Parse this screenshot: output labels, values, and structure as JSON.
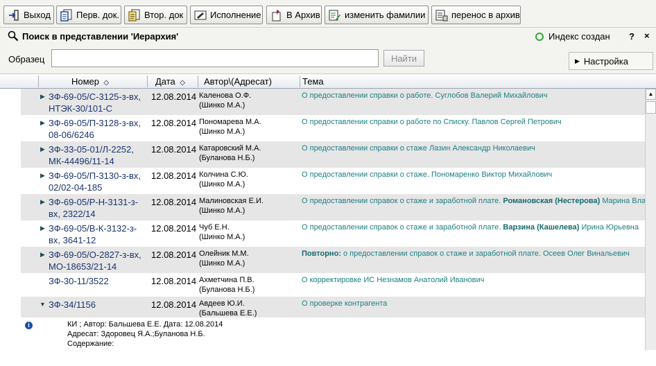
{
  "toolbar": {
    "buttons": [
      {
        "label": "Выход",
        "icon": "exit-icon"
      },
      {
        "label": "Перв. док.",
        "icon": "primary-doc-icon"
      },
      {
        "label": "Втор. док",
        "icon": "secondary-doc-icon"
      },
      {
        "label": "Исполнение",
        "icon": "execution-icon"
      },
      {
        "label": "В Архив",
        "icon": "archive-icon"
      },
      {
        "label": "изменить фамилии",
        "icon": "edit-names-icon"
      },
      {
        "label": "перенос в архив",
        "icon": "move-archive-icon"
      }
    ]
  },
  "search": {
    "title": "Поиск в представлении 'Иерархия'",
    "index_status": "Индекс создан",
    "help_label": "?",
    "close_label": "×",
    "pattern_label": "Образец",
    "pattern_value": "",
    "find_label": "Найти",
    "settings_label": "Настройка"
  },
  "columns": {
    "number": "Номер",
    "date": "Дата",
    "author": "Автор\\(Адресат)",
    "topic": "Тема"
  },
  "rows": [
    {
      "num1": "ЗФ-69-05/С-3125-з-вх,",
      "num2": "НТЭК-30/101-С",
      "date": "12.08.2014",
      "author1": "Каленова О.Ф.",
      "author2": "(Шинко М.А.)",
      "topic_prefix": "",
      "topic_bold": "",
      "topic": "О предоставлении справки о работе. Суглобов Валерий Михайлович"
    },
    {
      "num1": "ЗФ-69-05/П-3128-з-вх,",
      "num2": "08-06/6246",
      "date": "12.08.2014",
      "author1": "Пономарева М.А.",
      "author2": "(Шинко М.А.)",
      "topic_prefix": "",
      "topic_bold": "",
      "topic": "О предоставлении справки о работе по Списку. Павлов Сергей Петрович"
    },
    {
      "num1": "ЗФ-33-05-01/Л-2252,",
      "num2": "МК-44496/11-14",
      "date": "12.08.2014",
      "author1": "Катаровский М.А.",
      "author2": "(Буланова Н.Б.)",
      "topic_prefix": "",
      "topic_bold": "",
      "topic": "О предоставлении справки о стаже Лазин Александр Николаевич"
    },
    {
      "num1": "ЗФ-69-05/П-3130-з-вх,",
      "num2": "02/02-04-185",
      "date": "12.08.2014",
      "author1": "Колчина С.Ю.",
      "author2": "(Шинко М.А.)",
      "topic_prefix": "",
      "topic_bold": "",
      "topic": "О предоставлении справки о стаже. Пономаренко Виктор Михайлович"
    },
    {
      "num1": "ЗФ-69-05/Р-Н-3131-з-",
      "num2": "вх, 2322/14",
      "date": "12.08.2014",
      "author1": "Малиновская Е.И.",
      "author2": "(Шинко М.А.)",
      "topic_prefix": "О предоставлении справок о стаже и заработной плате. ",
      "topic_bold": "Романовская (Нестерова)",
      "topic": " Марина Влад"
    },
    {
      "num1": "ЗФ-69-05/В-К-3132-з-",
      "num2": "вх, 3641-12",
      "date": "12.08.2014",
      "author1": "Чуб Е.Н.",
      "author2": "(Шинко М.А.)",
      "topic_prefix": "О предоставлении справок о стаже и заработной плате. ",
      "topic_bold": "Варзина (Кашелева)",
      "topic": " Ирина Юрьевна"
    },
    {
      "num1": "ЗФ-69-05/О-2827-з-вх,",
      "num2": "МО-18653/21-14",
      "date": "12.08.2014",
      "author1": "Олейник М.М.",
      "author2": "(Шинко М.А.)",
      "topic_prefix": "",
      "topic_bold": "Повторно:",
      "topic": " о предоставлении справок о стаже и заработной плате. Осеев Олег Винальевич"
    },
    {
      "num1": "ЗФ-30-11/3522",
      "num2": "",
      "date": "12.08.2014",
      "author1": "Ахметчина П.В.",
      "author2": "(Буланова Н.Б.)",
      "topic_prefix": "",
      "topic_bold": "",
      "topic": "О корректировке ИС Незнамов Анатолий Иванович"
    },
    {
      "num1": "ЗФ-34/1156",
      "num2": "",
      "date": "12.08.2014",
      "author1": "Авдеев Ю.И.",
      "author2": "(Бальшева Е.Е.)",
      "topic_prefix": "",
      "topic_bold": "",
      "topic": "О проверке контрагента"
    }
  ],
  "details": {
    "line1": "КИ ; Автор: Бальшева Е.Е. Дата: 12.08.2014",
    "line2": "Адресат: Здоровец Я.А.;Буланова Н.Б.",
    "line3": "Содержание:"
  },
  "colors": {
    "topic_text": "#1d7f83",
    "number_text": "#1a3570",
    "row_gray": "#e6e6e6",
    "status_dot": "#3aa53a"
  }
}
